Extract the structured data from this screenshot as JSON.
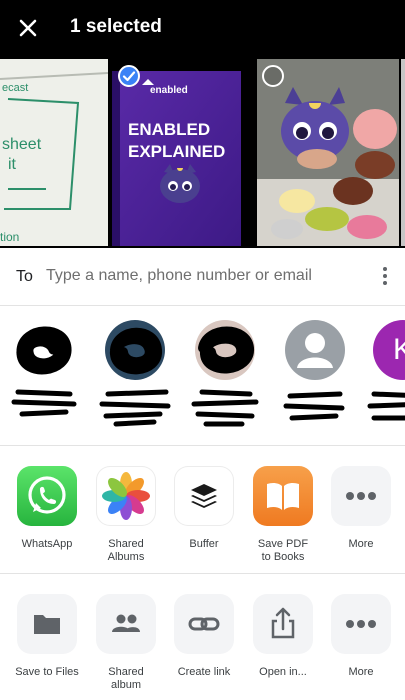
{
  "header": {
    "title": "1 selected",
    "close_icon": "close-icon"
  },
  "photos": [
    {
      "name": "whiteboard-photo",
      "selected": false
    },
    {
      "name": "enabled-explained-thumbnail",
      "selected": true,
      "brand": "enabled",
      "headline_1": "ENABLED",
      "headline_2": "EXPLAINED"
    },
    {
      "name": "squishy-cat-photo",
      "selected": false
    },
    {
      "name": "partial-photo",
      "selected": false
    }
  ],
  "to": {
    "label": "To",
    "placeholder": "Type a name, phone number or email"
  },
  "contacts": [
    {
      "type": "redacted"
    },
    {
      "type": "redacted"
    },
    {
      "type": "redacted"
    },
    {
      "type": "generic-person"
    },
    {
      "type": "letter",
      "letter": "K",
      "color": "#9c27b0"
    }
  ],
  "share_apps": [
    {
      "label": "WhatsApp",
      "icon": "whatsapp-icon"
    },
    {
      "label": "Shared\nAlbums",
      "icon": "photos-icon"
    },
    {
      "label": "Buffer",
      "icon": "buffer-icon"
    },
    {
      "label": "Save PDF\nto Books",
      "icon": "books-icon"
    },
    {
      "label": "More",
      "icon": "more-icon"
    }
  ],
  "actions": [
    {
      "label": "Save to Files",
      "icon": "folder-icon"
    },
    {
      "label": "Shared\nalbum",
      "icon": "people-icon"
    },
    {
      "label": "Create link",
      "icon": "link-icon"
    },
    {
      "label": "Open in...",
      "icon": "share-icon"
    },
    {
      "label": "More",
      "icon": "more-icon"
    }
  ],
  "colors": {
    "topbar": "#000000",
    "selection": "#3b82f6",
    "divider": "#e3e3e3"
  }
}
